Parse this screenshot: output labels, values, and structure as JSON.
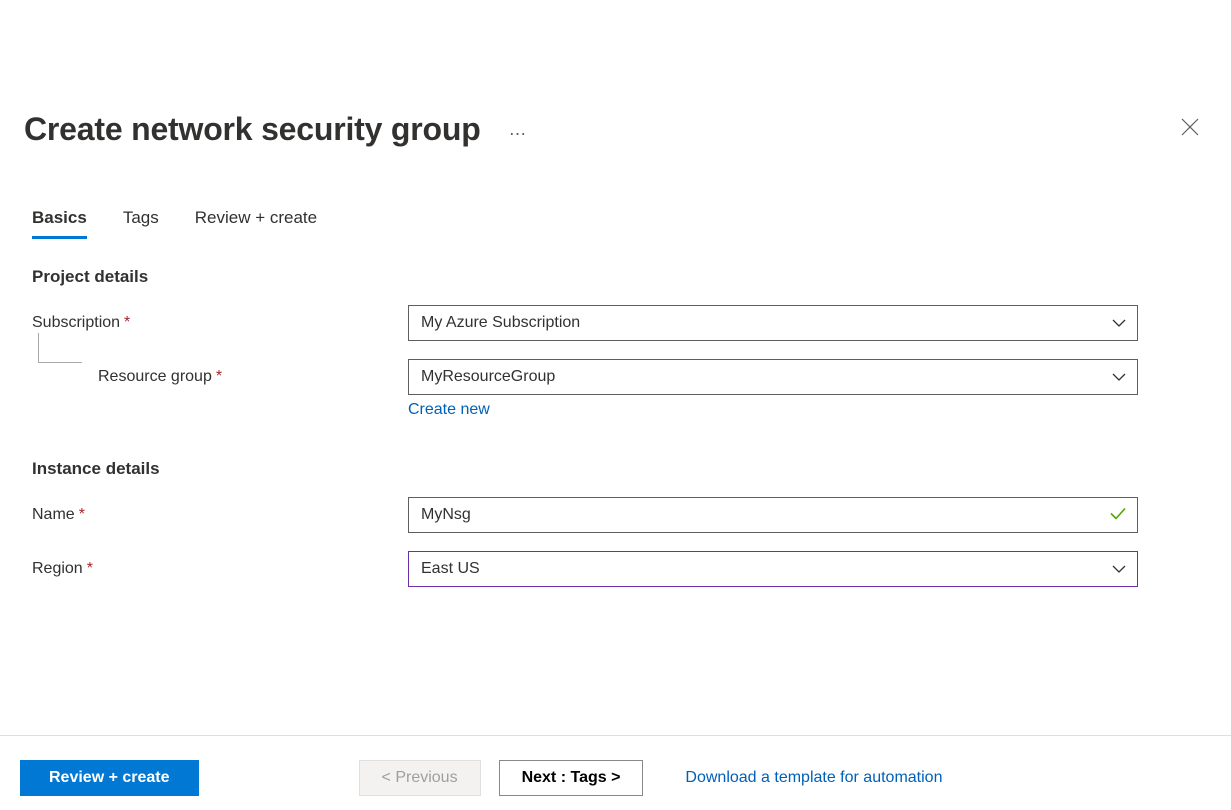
{
  "header": {
    "title": "Create network security group",
    "ellipsis": "…"
  },
  "tabs": {
    "basics": "Basics",
    "tags": "Tags",
    "review": "Review + create"
  },
  "project": {
    "heading": "Project details",
    "subscription_label": "Subscription",
    "subscription_value": "My Azure Subscription",
    "resource_group_label": "Resource group",
    "resource_group_value": "MyResourceGroup",
    "create_new": "Create new"
  },
  "instance": {
    "heading": "Instance details",
    "name_label": "Name",
    "name_value": "MyNsg",
    "region_label": "Region",
    "region_value": "East US"
  },
  "footer": {
    "review": "Review + create",
    "previous": "< Previous",
    "next": "Next : Tags >",
    "download": "Download a template for automation"
  },
  "required_marker": "*"
}
